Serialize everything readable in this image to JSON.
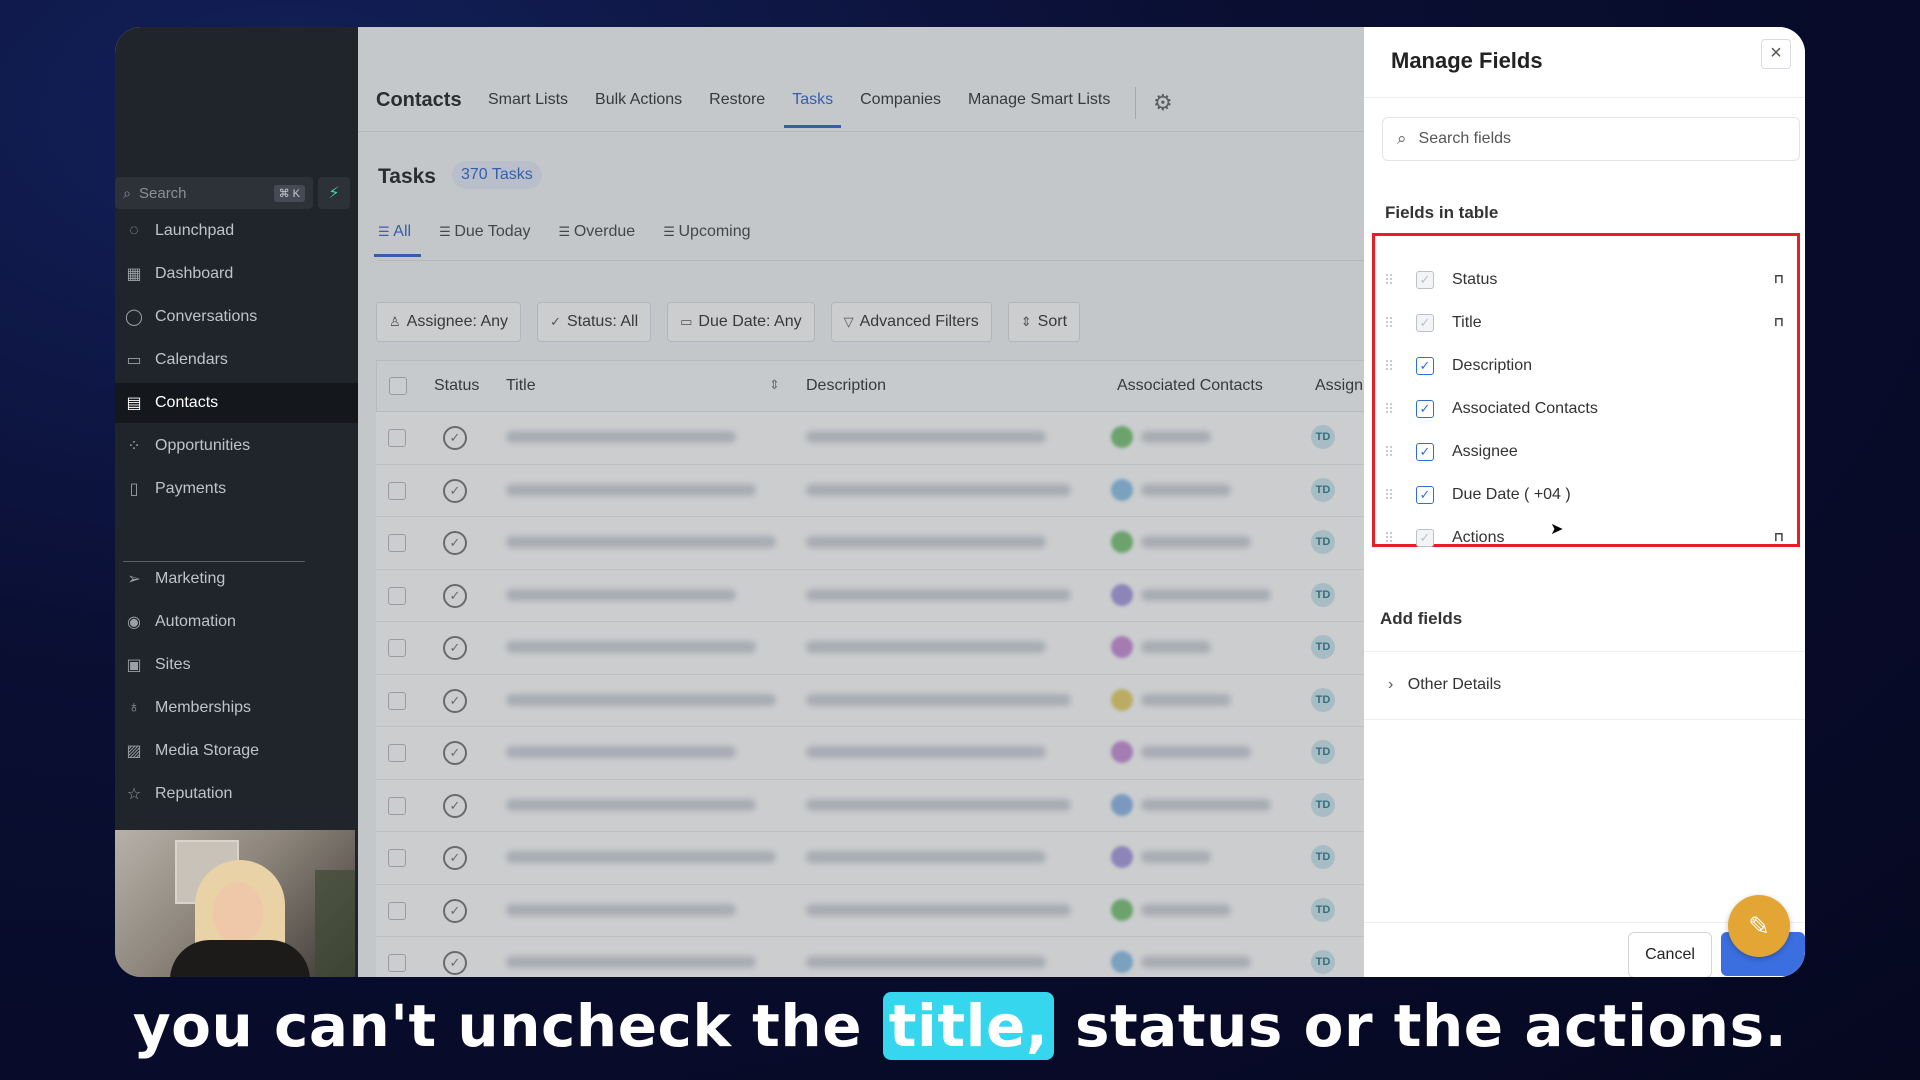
{
  "sidebar": {
    "search_label": "Search",
    "shortcut": "⌘ K",
    "items": [
      {
        "label": "Launchpad",
        "icon": "launchpad-icon",
        "glyph": "◌"
      },
      {
        "label": "Dashboard",
        "icon": "dashboard-icon",
        "glyph": "▦"
      },
      {
        "label": "Conversations",
        "icon": "chat-bubble-icon",
        "glyph": "◯"
      },
      {
        "label": "Calendars",
        "icon": "calendar-icon",
        "glyph": "▭"
      },
      {
        "label": "Contacts",
        "icon": "contacts-icon",
        "glyph": "▤"
      },
      {
        "label": "Opportunities",
        "icon": "opportunities-icon",
        "glyph": "⁘"
      },
      {
        "label": "Payments",
        "icon": "payments-icon",
        "glyph": "▯"
      },
      {
        "label": "Marketing",
        "icon": "send-icon",
        "glyph": "➢"
      },
      {
        "label": "Automation",
        "icon": "automation-icon",
        "glyph": "◉"
      },
      {
        "label": "Sites",
        "icon": "sites-icon",
        "glyph": "▣"
      },
      {
        "label": "Memberships",
        "icon": "memberships-icon",
        "glyph": "♁"
      },
      {
        "label": "Media Storage",
        "icon": "image-icon",
        "glyph": "▨"
      },
      {
        "label": "Reputation",
        "icon": "star-icon",
        "glyph": "☆"
      }
    ],
    "active": "Contacts"
  },
  "topnav": {
    "brand": "Contacts",
    "links": [
      "Smart Lists",
      "Bulk Actions",
      "Restore",
      "Tasks",
      "Companies",
      "Manage Smart Lists"
    ],
    "active": "Tasks"
  },
  "tasks": {
    "title": "Tasks",
    "count": "370 Tasks",
    "tabs": [
      "All",
      "Due Today",
      "Overdue",
      "Upcoming"
    ],
    "active_tab": "All",
    "filters": [
      {
        "label": "Assignee: Any",
        "icon": "user-icon",
        "glyph": "♙"
      },
      {
        "label": "Status: All",
        "icon": "check-icon",
        "glyph": "✓"
      },
      {
        "label": "Due Date: Any",
        "icon": "calendar-icon",
        "glyph": "▭"
      },
      {
        "label": "Advanced Filters",
        "icon": "filter-icon",
        "glyph": "▽"
      },
      {
        "label": "Sort",
        "icon": "sort-icon",
        "glyph": "⇕"
      }
    ],
    "columns": [
      "Status",
      "Title",
      "Description",
      "Associated Contacts",
      "Assign"
    ],
    "assignee_initials": "TD",
    "row_count": 12
  },
  "manage_fields": {
    "title": "Manage Fields",
    "search_placeholder": "Search fields",
    "fields_in_table_label": "Fields in table",
    "fields": [
      {
        "label": "Status",
        "checked": true,
        "locked": true
      },
      {
        "label": "Title",
        "checked": true,
        "locked": true
      },
      {
        "label": "Description",
        "checked": true,
        "locked": false
      },
      {
        "label": "Associated Contacts",
        "checked": true,
        "locked": false
      },
      {
        "label": "Assignee",
        "checked": true,
        "locked": false
      },
      {
        "label": "Due Date ( +04 )",
        "checked": true,
        "locked": false
      },
      {
        "label": "Actions",
        "checked": true,
        "locked": true
      }
    ],
    "add_fields_label": "Add fields",
    "other_details_label": "Other Details",
    "cancel_label": "Cancel"
  },
  "caption": {
    "before": "you can't uncheck the",
    "highlight": "title,",
    "after": "status or the actions."
  },
  "colors": {
    "accent": "#3366cc",
    "highlight_box": "#e41f25",
    "caption_highlight": "#35d6ee",
    "chat_button": "#e3a534"
  }
}
